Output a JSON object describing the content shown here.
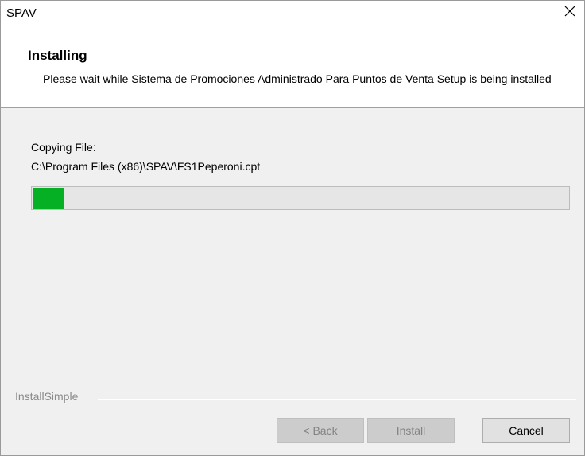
{
  "window": {
    "title": "SPAV"
  },
  "header": {
    "title": "Installing",
    "description": "Please wait while Sistema de Promociones Administrado Para Puntos de Venta Setup is being installed"
  },
  "status": {
    "label": "Copying File:",
    "path": "C:\\Program Files (x86)\\SPAV\\FS1Peperoni.cpt"
  },
  "progress": {
    "fraction": 0.06,
    "color": "#06b025"
  },
  "footer": {
    "brand": "InstallSimple"
  },
  "buttons": {
    "back": "< Back",
    "install": "Install",
    "cancel": "Cancel"
  },
  "icons": {
    "close": "close-icon"
  }
}
